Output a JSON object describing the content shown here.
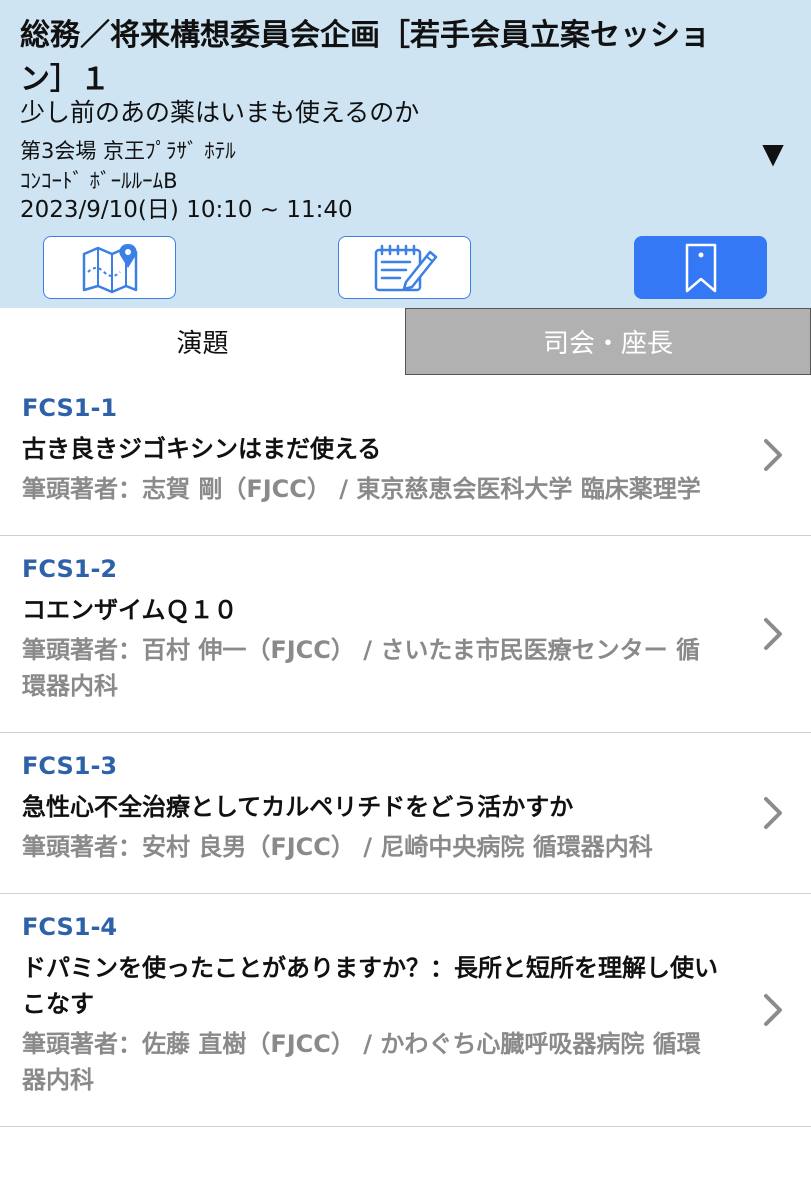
{
  "session": {
    "title": "総務／将来構想委員会企画［若手会員立案セッション］１",
    "subtitle": "少し前のあの薬はいまも使えるのか",
    "venue_line1": "第3会場 京王ﾌﾟﾗｻﾞ ﾎﾃﾙ",
    "venue_line2": "ｺﾝｺｰﾄﾞ ﾎﾞｰﾙﾙｰﾑB",
    "datetime": "2023/9/10(日) 10:10 ~ 11:40",
    "expand_symbol": "▼"
  },
  "actions": {
    "map_icon": "map-pin-icon",
    "memo_icon": "notepad-pencil-icon",
    "bookmark_icon": "bookmark-icon",
    "accent_color": "#3478f6"
  },
  "tabs": [
    {
      "label": "演題",
      "active": true
    },
    {
      "label": "司会・座長",
      "active": false
    }
  ],
  "presentations": [
    {
      "code": "FCS1-1",
      "title": "古き良きジゴキシンはまだ使える",
      "author": "筆頭著者：志賀 剛（FJCC） / 東京慈恵会医科大学 臨床薬理学"
    },
    {
      "code": "FCS1-2",
      "title": "コエンザイムＱ１０",
      "author": "筆頭著者：百村 伸一（FJCC） / さいたま市民医療センター 循環器内科"
    },
    {
      "code": "FCS1-3",
      "title": "急性心不全治療としてカルペリチドをどう活かすか",
      "author": "筆頭著者：安村 良男（FJCC） / 尼崎中央病院 循環器内科"
    },
    {
      "code": "FCS1-4",
      "title": "ドパミンを使ったことがありますか？：長所と短所を理解し使いこなす",
      "author": "筆頭著者：佐藤 直樹（FJCC） / かわぐち心臓呼吸器病院 循環器内科"
    }
  ]
}
